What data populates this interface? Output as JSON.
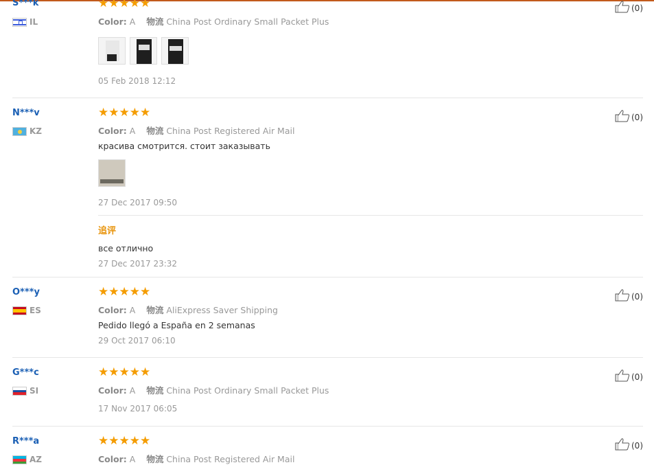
{
  "labels": {
    "color": "Color:",
    "shipping": "物流",
    "append": "追评"
  },
  "reviews": [
    {
      "name": "S***k",
      "country": "IL",
      "rating": "★★★★★",
      "color": "A",
      "shipping": "China Post Ordinary Small Packet Plus",
      "text": "",
      "date": "05 Feb 2018 12:12",
      "likes": "(0)",
      "photos": 3
    },
    {
      "name": "N***v",
      "country": "KZ",
      "rating": "★★★★★",
      "color": "A",
      "shipping": "China Post Registered Air Mail",
      "text": "красива смотрится. стоит заказывать",
      "date": "27 Dec 2017 09:50",
      "likes": "(0)",
      "photos": 1,
      "followup_text": "все отлично",
      "followup_date": "27 Dec 2017 23:32"
    },
    {
      "name": "O***y",
      "country": "ES",
      "rating": "★★★★★",
      "color": "A",
      "shipping": "AliExpress Saver Shipping",
      "text": "Pedido llegó a España en 2 semanas",
      "date": "29 Oct 2017 06:10",
      "likes": "(0)"
    },
    {
      "name": "G***c",
      "country": "SI",
      "rating": "★★★★★",
      "color": "A",
      "shipping": "China Post Ordinary Small Packet Plus",
      "text": "",
      "date": "17 Nov 2017 06:05",
      "likes": "(0)"
    },
    {
      "name": "R***a",
      "country": "AZ",
      "rating": "★★★★★",
      "color": "A",
      "shipping": "China Post Registered Air Mail",
      "text": "",
      "date": "",
      "likes": "(0)"
    }
  ],
  "colors": {
    "accent": "#f49c00",
    "name": "#1a5fb4",
    "topline": "#c25a1c"
  }
}
